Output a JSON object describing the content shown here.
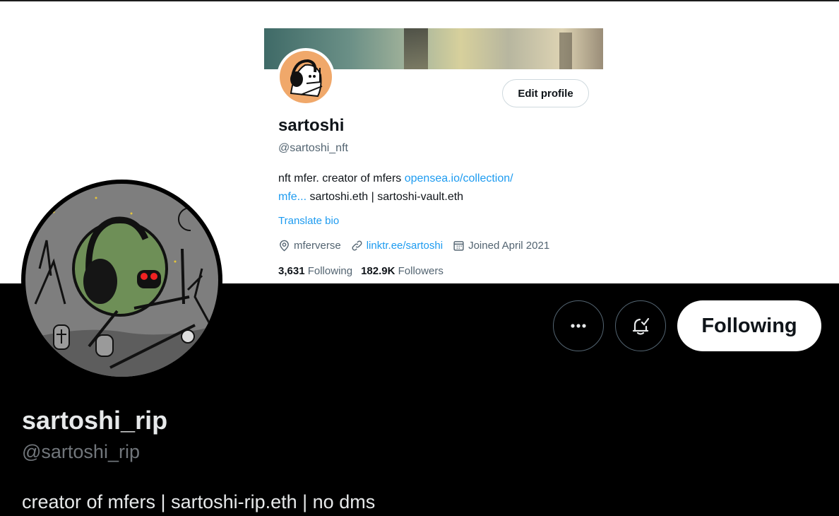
{
  "embedded_profile": {
    "name": "sartoshi",
    "handle": "@sartoshi_nft",
    "edit_button": "Edit profile",
    "bio_text": "nft mfer. creator of mfers ",
    "bio_link_1": "opensea.io/collection/",
    "bio_link_2": "mfe...",
    "bio_text_2": " sartoshi.eth | sartoshi-vault.eth",
    "translate": "Translate bio",
    "location": "mferverse",
    "website": "linktr.ee/sartoshi",
    "joined": "Joined April 2021",
    "following_count": "3,631",
    "following_label": "Following",
    "followers_count": "182.9K",
    "followers_label": "Followers",
    "link_color": "#1d9bf0"
  },
  "profile": {
    "name": "sartoshi_rip",
    "handle": "@sartoshi_rip",
    "bio": "creator of mfers | sartoshi-rip.eth | no dms",
    "following_button": "Following"
  },
  "icons": {
    "more": "more-icon",
    "notify": "bell-check-icon",
    "location": "location-icon",
    "link": "link-icon",
    "calendar": "calendar-icon"
  }
}
